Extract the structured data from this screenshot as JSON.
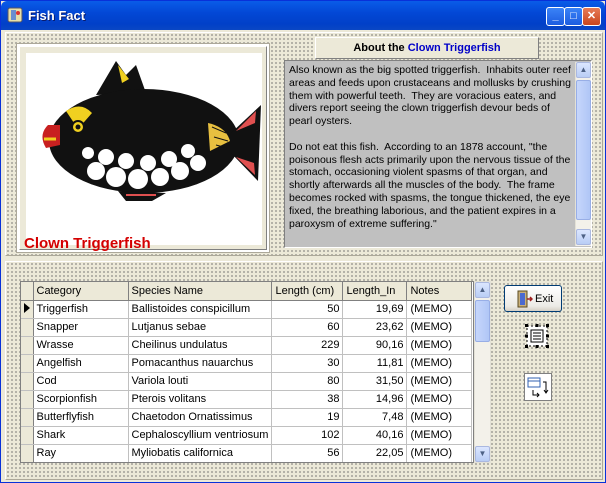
{
  "window": {
    "title": "Fish Fact"
  },
  "about": {
    "prefix": "About the",
    "fish_name": "Clown Triggerfish"
  },
  "caption": "Clown Triggerfish",
  "memo": {
    "text": "Also known as the big spotted triggerfish.  Inhabits outer reef areas and feeds upon crustaceans and mollusks by crushing them with powerful teeth.  They are voracious eaters, and divers report seeing the clown triggerfish devour beds of pearl oysters.\n\nDo not eat this fish.  According to an 1878 account, \"the poisonous flesh acts primarily upon the nervous tissue of the stomach, occasioning violent spasms of that organ, and shortly afterwards all the muscles of the body.  The frame becomes rocked with spasms, the tongue thickened, the eye fixed, the breathing laborious, and the patient expires in a paroxysm of extreme suffering.\""
  },
  "grid": {
    "columns": [
      "Category",
      "Species Name",
      "Length (cm)",
      "Length_In",
      "Notes"
    ],
    "rows": [
      [
        "Triggerfish",
        "Ballistoides conspicillum",
        "50",
        "19,69",
        "(MEMO)"
      ],
      [
        "Snapper",
        "Lutjanus sebae",
        "60",
        "23,62",
        "(MEMO)"
      ],
      [
        "Wrasse",
        "Cheilinus undulatus",
        "229",
        "90,16",
        "(MEMO)"
      ],
      [
        "Angelfish",
        "Pomacanthus nauarchus",
        "30",
        "11,81",
        "(MEMO)"
      ],
      [
        "Cod",
        "Variola louti",
        "80",
        "31,50",
        "(MEMO)"
      ],
      [
        "Scorpionfish",
        "Pterois volitans",
        "38",
        "14,96",
        "(MEMO)"
      ],
      [
        "Butterflyfish",
        "Chaetodon Ornatissimus",
        "19",
        "7,48",
        "(MEMO)"
      ],
      [
        "Shark",
        "Cephaloscyllium ventriosum",
        "102",
        "40,16",
        "(MEMO)"
      ],
      [
        "Ray",
        "Myliobatis californica",
        "56",
        "22,05",
        "(MEMO)"
      ]
    ]
  },
  "buttons": {
    "exit": "Exit"
  },
  "icons": {
    "app": "fish-app-icon",
    "exit": "door-icon",
    "dbnav": "database-navigator-icon",
    "dbtable": "table-link-icon"
  },
  "colors": {
    "titlebar": "#0348d6",
    "caption": "#d40000",
    "fish_name": "#0000c8"
  }
}
